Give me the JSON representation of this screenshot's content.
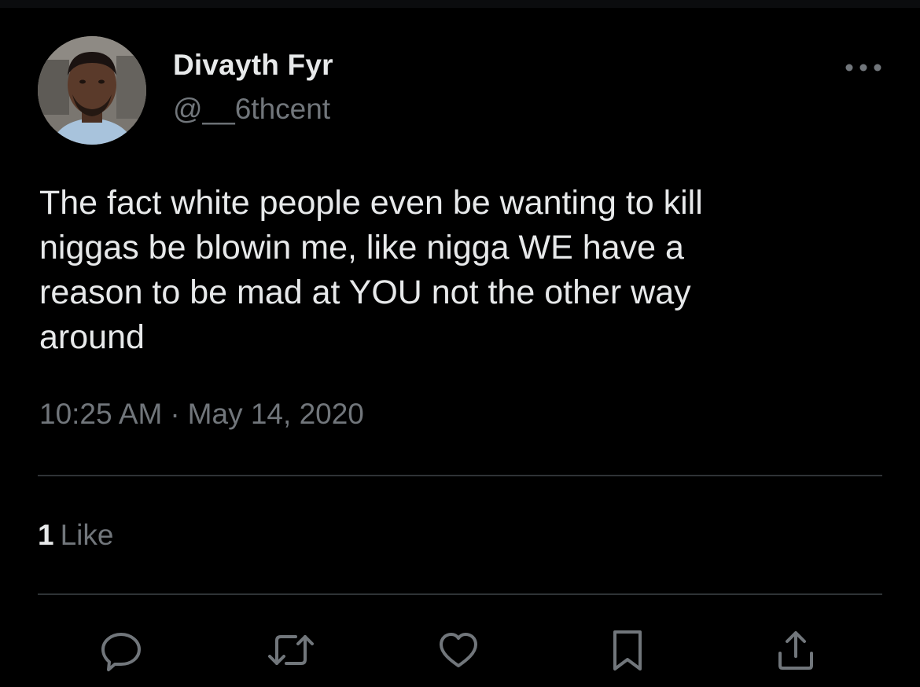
{
  "tweet": {
    "author": {
      "display_name": "Divayth Fyr",
      "handle": "@__6thcent"
    },
    "text": "The fact white people even be wanting to kill\nniggas be blowin me, like nigga WE have a\nreason to be mad at YOU not the other way\naround",
    "time": "10:25 AM",
    "separator": "·",
    "date": "May 14, 2020",
    "stats": {
      "likes_count": "1",
      "likes_label": "Like"
    }
  },
  "icons": {
    "more": "more-horizontal-icon",
    "reply": "reply-bubble-icon",
    "retweet": "retweet-icon",
    "like": "heart-icon",
    "bookmark": "bookmark-icon",
    "share": "share-upload-icon"
  },
  "colors": {
    "background": "#000000",
    "primary_text": "#e7e9ea",
    "secondary_text": "#71767b",
    "divider": "#2f3336"
  }
}
